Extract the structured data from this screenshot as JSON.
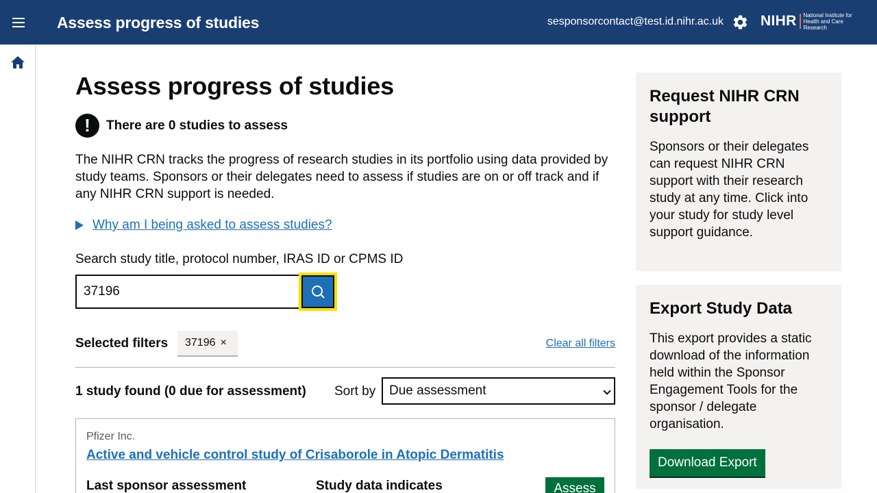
{
  "header": {
    "app_title": "Assess progress of studies",
    "user_email": "sesponsorcontact@test.id.nihr.ac.uk",
    "logo_main": "NIHR",
    "logo_sub_line1": "National Institute for",
    "logo_sub_line2": "Health and Care Research"
  },
  "main": {
    "page_title": "Assess progress of studies",
    "warning_text": "There are 0 studies to assess",
    "warning_symbol": "!",
    "intro": "The NIHR CRN tracks the progress of research studies in its portfolio using data provided by study teams. Sponsors or their delegates need to assess if studies are on or off track and if any NIHR CRN support is needed.",
    "details_summary": "Why am I being asked to assess studies?",
    "search": {
      "label": "Search study title, protocol number, IRAS ID or CPMS ID",
      "value": "37196"
    },
    "filters": {
      "label": "Selected filters",
      "tags": [
        "37196"
      ],
      "tag_remove_symbol": "×",
      "clear_all": "Clear all filters"
    },
    "results": {
      "count_text": "1 study found (0 due for assessment)",
      "sort_label": "Sort by",
      "sort_selected": "Due assessment"
    },
    "study": {
      "sponsor": "Pfizer Inc.",
      "title": "Active and vehicle control study of Crisaborole in Atopic Dermatitis",
      "col_last_assessment": "Last sponsor assessment",
      "col_data_indicates": "Study data indicates",
      "assess_label": "Assess"
    }
  },
  "aside": {
    "support": {
      "heading": "Request NIHR CRN support",
      "body": "Sponsors or their delegates can request NIHR CRN support with their research study at any time. Click into your study for study level support guidance."
    },
    "export": {
      "heading": "Export Study Data",
      "body": "This export provides a static download of the information held within the Sponsor Engagement Tools for the sponsor / delegate organisation.",
      "button": "Download Export"
    }
  },
  "colors": {
    "header_bg": "#193e72",
    "link": "#1d70b8",
    "button_green": "#00703c",
    "focus_yellow": "#ffdd00",
    "panel_bg": "#f3f2f1"
  },
  "icons": [
    "menu-icon",
    "settings-gear-icon",
    "home-icon",
    "warning-icon",
    "search-icon",
    "close-icon",
    "chevron-down-icon",
    "details-triangle-icon"
  ]
}
